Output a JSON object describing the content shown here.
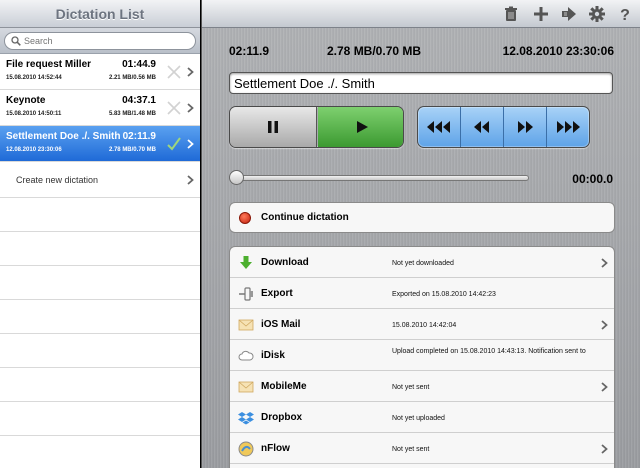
{
  "left_panel": {
    "title": "Dictation List",
    "search": {
      "placeholder": "Search"
    },
    "dictations": [
      {
        "name": "File request Miller",
        "duration": "01:44.9",
        "date": "15.08.2010 14:52:44",
        "size": "2.21 MB/0.56 MB",
        "selected": false
      },
      {
        "name": "Keynote",
        "duration": "04:37.1",
        "date": "15.08.2010 14:50:11",
        "size": "5.83 MB/1.48 MB",
        "selected": false
      },
      {
        "name": "Settlement Doe ./. Smith",
        "duration": "02:11.9",
        "date": "12.08.2010 23:30:06",
        "size": "2.78 MB/0.70 MB",
        "selected": true
      }
    ],
    "create_label": "Create new dictation"
  },
  "toolbar": {
    "icons": [
      "trash-icon",
      "plus-icon",
      "share-icon",
      "gear-icon",
      "help-icon"
    ]
  },
  "detail": {
    "duration": "02:11.9",
    "size": "2.78 MB/0.70 MB",
    "datetime": "12.08.2010 23:30:06",
    "title_value": "Settlement Doe ./. Smith",
    "position_time": "00:00.0",
    "playhead_fraction": 0,
    "continue_label": "Continue dictation"
  },
  "exports": [
    {
      "name": "Download",
      "icon": "download-arrow-icon",
      "status": "Not yet downloaded",
      "chevron": true
    },
    {
      "name": "Export",
      "icon": "export-connector-icon",
      "status": "Exported on 15.08.2010 14:42:23",
      "chevron": false
    },
    {
      "name": "iOS Mail",
      "icon": "mail-envelope-icon",
      "status": "15.08.2010 14:42:04",
      "chevron": true
    },
    {
      "name": "iDisk",
      "icon": "cloud-icon",
      "status": "Upload completed on 15.08.2010 14:43:13. Notification sent to",
      "chevron": false
    },
    {
      "name": "MobileMe",
      "icon": "mail-envelope-icon",
      "status": "Not yet sent",
      "chevron": true
    },
    {
      "name": "Dropbox",
      "icon": "dropbox-icon",
      "status": "Not yet uploaded",
      "chevron": false
    },
    {
      "name": "nFlow",
      "icon": "nflow-icon",
      "status": "Not yet sent",
      "chevron": true
    }
  ],
  "colors": {
    "selected_row": "#1f6ad7",
    "play_green": "#3c9a31",
    "nav_blue": "#5ea3e8",
    "record_red": "#c3200d"
  }
}
